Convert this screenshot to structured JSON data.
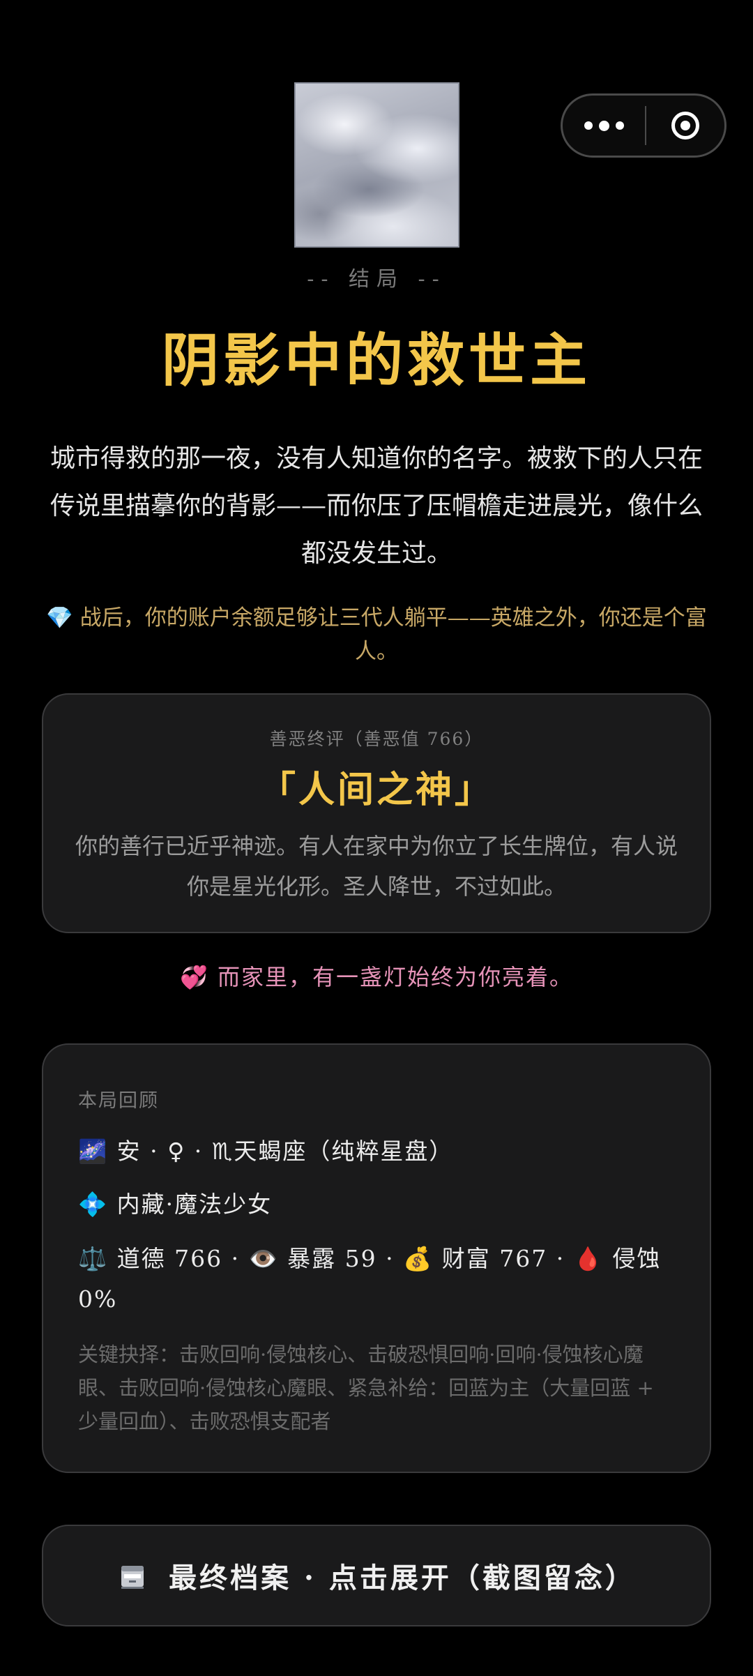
{
  "capsule": {
    "more_icon": "more-dots-icon",
    "close_icon": "target-circle-icon"
  },
  "ending": {
    "label": "-- 结局 --",
    "title": "阴影中的救世主",
    "description": "城市得救的那一夜，没有人知道你的名字。被救下的人只在传说里描摹你的背影——而你压了压帽檐走进晨光，像什么都没发生过。",
    "wealth_icon": "💎",
    "wealth_text": "战后，你的账户余额足够让三代人躺平——英雄之外，你还是个富人。"
  },
  "verdict": {
    "heading": "善恶终评（善恶值 766）",
    "title": "「人间之神」",
    "description": "你的善行已近乎神迹。有人在家中为你立了长生牌位，有人说你是星光化形。圣人降世，不过如此。"
  },
  "family": {
    "icon": "💞",
    "text": "而家里，有一盏灯始终为你亮着。"
  },
  "review": {
    "heading": "本局回顾",
    "line1": {
      "icon": "🌌",
      "name": "安",
      "sep1": "·",
      "gender": "♀",
      "sep2": "·",
      "zodiac_icon": "♏",
      "zodiac": "天蝎座（纯粹星盘）"
    },
    "line2": {
      "icon": "💠",
      "text": "内藏·魔法少女"
    },
    "line3": {
      "morality_icon": "⚖️",
      "morality": "道德 766",
      "sep": "·",
      "exposure_icon": "👁️",
      "exposure": "暴露 59",
      "wealth_icon": "💰",
      "wealth": "财富 767",
      "corrosion_icon": "🩸",
      "corrosion": "侵蚀 0%"
    },
    "key_choices": "关键抉择：击败回响·侵蚀核心、击破恐惧回响·回响·侵蚀核心魔眼、击败回响·侵蚀核心魔眼、紧急补给：回蓝为主（大量回蓝 + 少量回血）、击败恐惧支配者"
  },
  "archive_button": {
    "icon": "file-cabinet-icon",
    "label": "最终档案 · 点击展开（截图留念）"
  },
  "colors": {
    "background": "#000000",
    "title_gold": "#f3c64a",
    "wealth_gold": "#c8a866",
    "family_pink": "#e693b8",
    "card_bg": "#1a1a1b"
  }
}
